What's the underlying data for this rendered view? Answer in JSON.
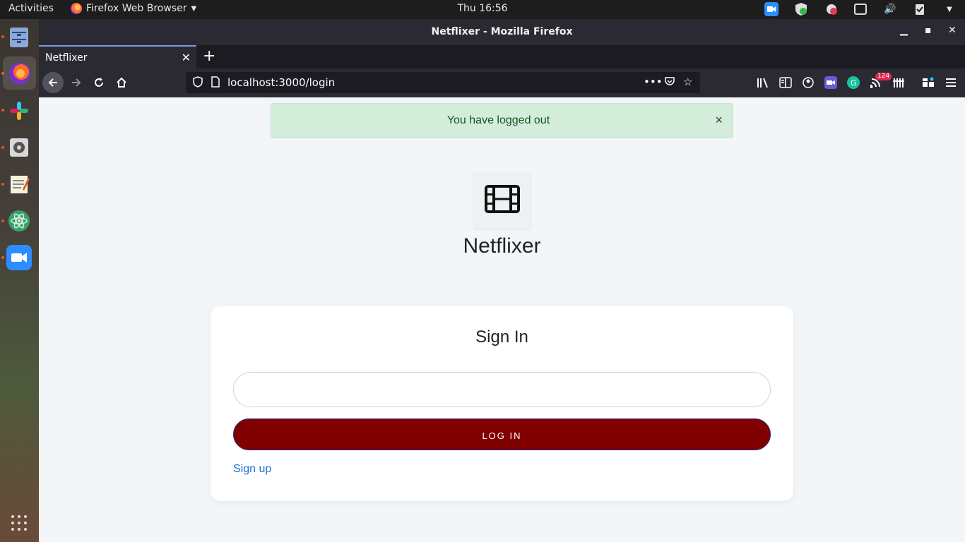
{
  "system": {
    "activities_label": "Activities",
    "app_menu_label": "Firefox Web Browser",
    "clock": "Thu 16:56"
  },
  "window": {
    "title": "Netflixer - Mozilla Firefox"
  },
  "tabs": [
    {
      "label": "Netflixer"
    }
  ],
  "urlbar": {
    "url": "localhost:3000/login",
    "overflow_label": "•••"
  },
  "toolbar": {
    "feed_badge": "124"
  },
  "page": {
    "alert_message": "You have logged out",
    "alert_close": "×",
    "brand_name": "Netflixer",
    "card_title": "Sign In",
    "input_value": "",
    "login_button": "LOG IN",
    "signup_link": "Sign up"
  },
  "colors": {
    "alert_bg": "#d4edda",
    "alert_text": "#155724",
    "login_button_bg": "#800000",
    "link": "#1a73c8"
  },
  "icons": {
    "page_logo": "film-icon",
    "dock": [
      "files-icon",
      "firefox-icon",
      "slack-icon",
      "settings-icon",
      "text-editor-icon",
      "atom-icon",
      "zoom-icon"
    ]
  }
}
